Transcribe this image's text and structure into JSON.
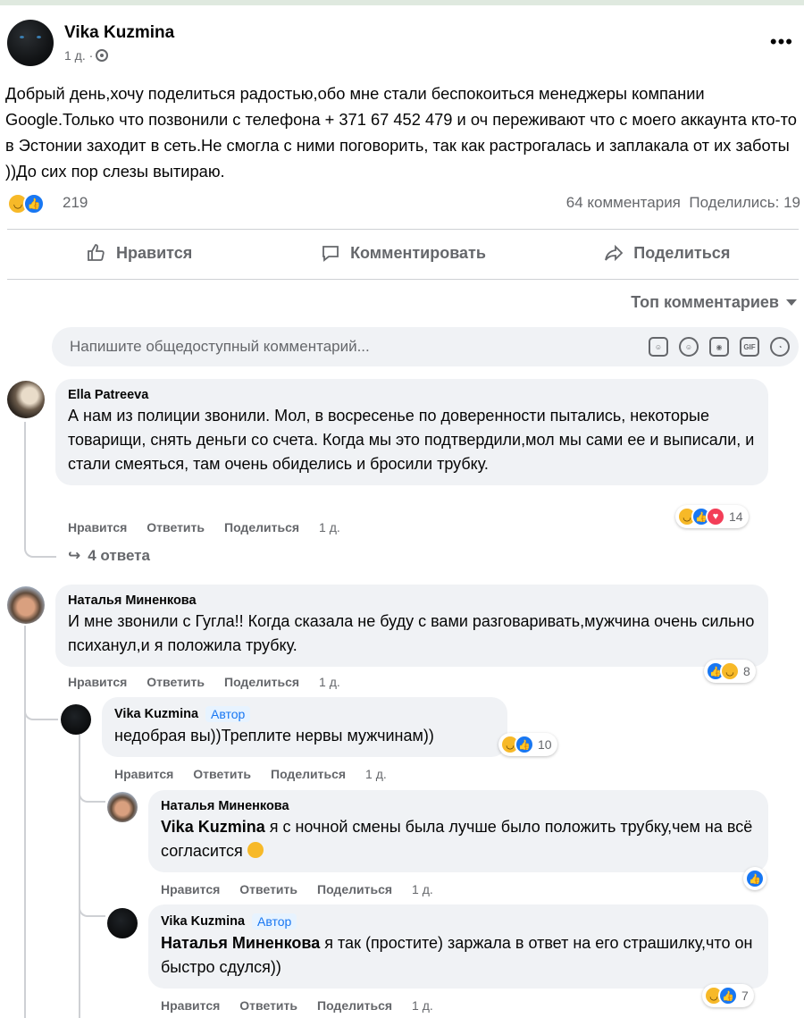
{
  "post": {
    "author": "Vika Kuzmina",
    "time": "1 д. ·",
    "more": "•••",
    "text": "Добрый день,хочу поделиться радостью,обо мне стали беспокоиться менеджеры компании Google.Только что позвонили с телефона + 371 67 452 479 и оч переживают что с моего аккаунта кто-то в Эстонии заходит в сеть.Не смогла с ними поговорить, так как растрогалась и заплакала от их заботы ))До сих пор слезы  вытираю.",
    "reactions_count": "219",
    "comments_count": "64 комментария",
    "shares": "Поделились: 19"
  },
  "actions": {
    "like": "Нравится",
    "comment": "Комментировать",
    "share": "Поделиться"
  },
  "sort_label": "Топ комментариев",
  "compose": {
    "placeholder": "Напишите общедоступный комментарий..."
  },
  "comment_actions": {
    "like": "Нравится",
    "reply": "Ответить",
    "share": "Поделиться"
  },
  "comments": [
    {
      "author": "Ella Patreeva",
      "text": "А нам из полиции звонили. Мол, в восресенье по доверенности пытались, некоторые товарищи, снять деньги со счета. Когда мы это подтвердили,мол мы сами ее и выписали, и стали смеяться, там очень обиделись и бросили трубку.",
      "time": "1 д.",
      "reactions": "14",
      "replies_link": "4 ответа"
    },
    {
      "author": "Наталья Миненкова",
      "text": "И мне звонили с Гугла!! Когда сказала не буду с вами разговаривать,мужчина очень сильно психанул,и я положила трубку.",
      "time": "1 д.",
      "reactions": "8"
    },
    {
      "author": "Vika Kuzmina",
      "badge": "Автор",
      "text": "недобрая вы))Треплите нервы мужчинам))",
      "time": "1 д.",
      "reactions": "10"
    },
    {
      "author": "Наталья Миненкова",
      "mention": "Vika Kuzmina",
      "text": " я с ночной смены была лучше было положить трубку,чем на всё согласится",
      "time": "1 д."
    },
    {
      "author": "Vika Kuzmina",
      "badge": "Автор",
      "mention": "Наталья Миненкова",
      "text": " я так (простите) заржала в ответ на его страшилку,что он быстро сдулся))",
      "time": "1 д.",
      "reactions": "7"
    }
  ]
}
